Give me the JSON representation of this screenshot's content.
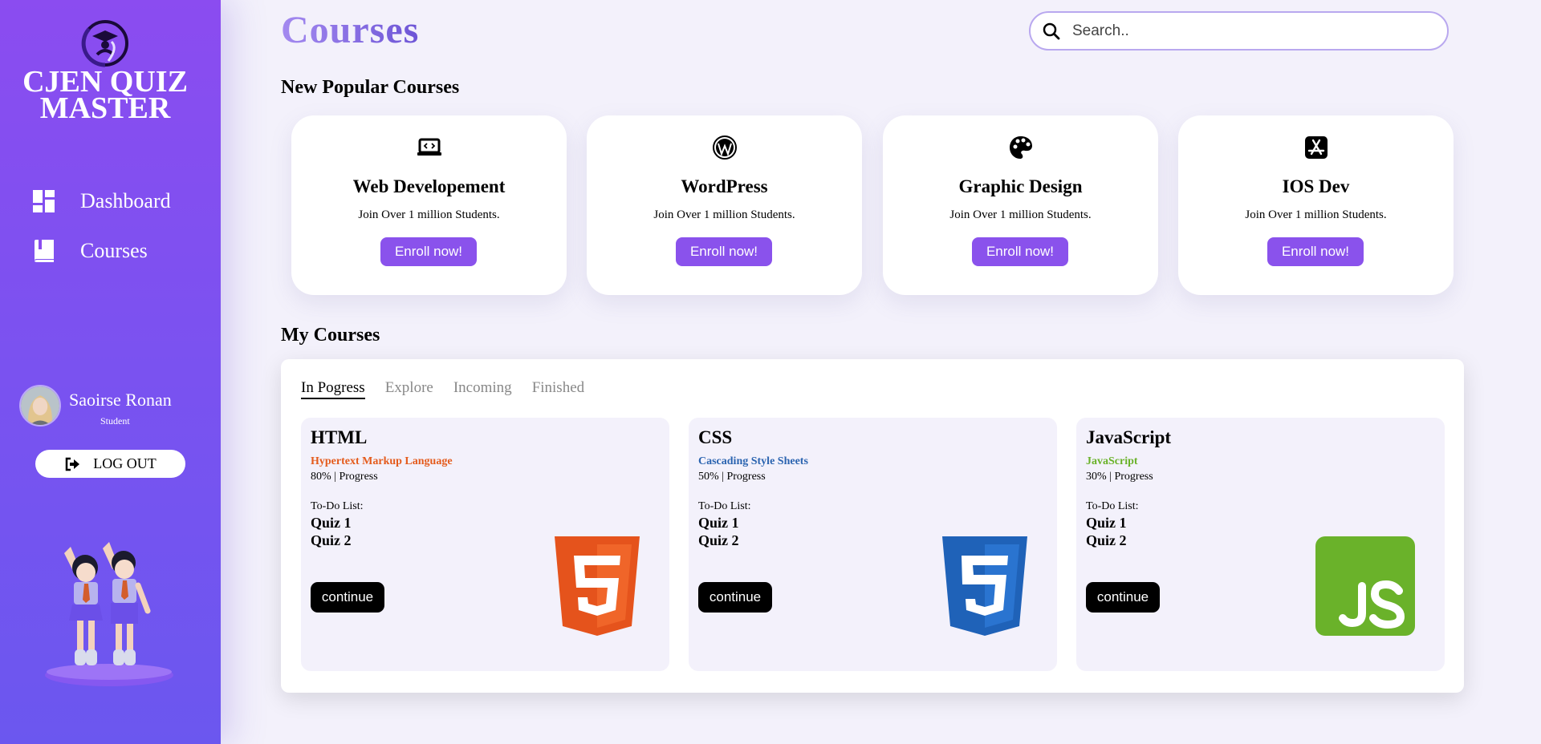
{
  "sidebar": {
    "brand": "CJEN QUIZ MASTER",
    "nav": [
      {
        "label": "Dashboard",
        "icon": "dashboard-icon"
      },
      {
        "label": "Courses",
        "icon": "book-icon"
      }
    ],
    "user": {
      "name": "Saoirse Ronan",
      "role": "Student"
    },
    "logout_label": "LOG OUT"
  },
  "header": {
    "title": "Courses",
    "search_placeholder": "Search.."
  },
  "popular": {
    "title": "New Popular Courses",
    "cards": [
      {
        "title": "Web Developement",
        "subtitle": "Join Over 1 million Students.",
        "button": "Enroll now!",
        "icon": "laptop-code-icon"
      },
      {
        "title": "WordPress",
        "subtitle": "Join Over 1 million Students.",
        "button": "Enroll now!",
        "icon": "wordpress-icon"
      },
      {
        "title": "Graphic Design",
        "subtitle": "Join Over 1 million Students.",
        "button": "Enroll now!",
        "icon": "palette-icon"
      },
      {
        "title": "IOS Dev",
        "subtitle": "Join Over 1 million Students.",
        "button": "Enroll now!",
        "icon": "app-store-icon"
      }
    ]
  },
  "my_courses": {
    "title": "My Courses",
    "tabs": [
      "In Pogress",
      "Explore",
      "Incoming",
      "Finished"
    ],
    "active_tab": "In Pogress",
    "courses": [
      {
        "name": "HTML",
        "subtitle": "Hypertext Markup Language",
        "subtitle_color": "#e45b1c",
        "progress": "80% | Progress",
        "todo": "To-Do List:",
        "quiz1": "Quiz 1",
        "quiz2": "Quiz 2",
        "button": "continue",
        "logo": "html5-icon"
      },
      {
        "name": "CSS",
        "subtitle": "Cascading Style Sheets",
        "subtitle_color": "#2b64b0",
        "progress": "50% | Progress",
        "todo": "To-Do List:",
        "quiz1": "Quiz 1",
        "quiz2": "Quiz 2",
        "button": "continue",
        "logo": "css3-icon"
      },
      {
        "name": "JavaScript",
        "subtitle": "JavaScript",
        "subtitle_color": "#6ab22a",
        "progress": "30% | Progress",
        "todo": "To-Do List:",
        "quiz1": "Quiz 1",
        "quiz2": "Quiz 2",
        "button": "continue",
        "logo": "js-icon"
      }
    ]
  },
  "colors": {
    "accent": "#8a52ec",
    "sidebar": "#7a52f0",
    "background": "#f3f1fb"
  }
}
